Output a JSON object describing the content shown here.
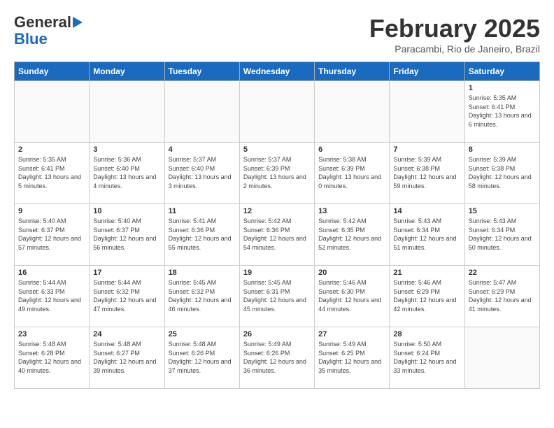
{
  "header": {
    "logo_line1": "General",
    "logo_line2": "Blue",
    "title": "February 2025",
    "subtitle": "Paracambi, Rio de Janeiro, Brazil"
  },
  "days_of_week": [
    "Sunday",
    "Monday",
    "Tuesday",
    "Wednesday",
    "Thursday",
    "Friday",
    "Saturday"
  ],
  "weeks": [
    [
      {
        "num": "",
        "info": ""
      },
      {
        "num": "",
        "info": ""
      },
      {
        "num": "",
        "info": ""
      },
      {
        "num": "",
        "info": ""
      },
      {
        "num": "",
        "info": ""
      },
      {
        "num": "",
        "info": ""
      },
      {
        "num": "1",
        "info": "Sunrise: 5:35 AM\nSunset: 6:41 PM\nDaylight: 13 hours and 6 minutes."
      }
    ],
    [
      {
        "num": "2",
        "info": "Sunrise: 5:35 AM\nSunset: 6:41 PM\nDaylight: 13 hours and 5 minutes."
      },
      {
        "num": "3",
        "info": "Sunrise: 5:36 AM\nSunset: 6:40 PM\nDaylight: 13 hours and 4 minutes."
      },
      {
        "num": "4",
        "info": "Sunrise: 5:37 AM\nSunset: 6:40 PM\nDaylight: 13 hours and 3 minutes."
      },
      {
        "num": "5",
        "info": "Sunrise: 5:37 AM\nSunset: 6:39 PM\nDaylight: 13 hours and 2 minutes."
      },
      {
        "num": "6",
        "info": "Sunrise: 5:38 AM\nSunset: 6:39 PM\nDaylight: 13 hours and 0 minutes."
      },
      {
        "num": "7",
        "info": "Sunrise: 5:39 AM\nSunset: 6:38 PM\nDaylight: 12 hours and 59 minutes."
      },
      {
        "num": "8",
        "info": "Sunrise: 5:39 AM\nSunset: 6:38 PM\nDaylight: 12 hours and 58 minutes."
      }
    ],
    [
      {
        "num": "9",
        "info": "Sunrise: 5:40 AM\nSunset: 6:37 PM\nDaylight: 12 hours and 57 minutes."
      },
      {
        "num": "10",
        "info": "Sunrise: 5:40 AM\nSunset: 6:37 PM\nDaylight: 12 hours and 56 minutes."
      },
      {
        "num": "11",
        "info": "Sunrise: 5:41 AM\nSunset: 6:36 PM\nDaylight: 12 hours and 55 minutes."
      },
      {
        "num": "12",
        "info": "Sunrise: 5:42 AM\nSunset: 6:36 PM\nDaylight: 12 hours and 54 minutes."
      },
      {
        "num": "13",
        "info": "Sunrise: 5:42 AM\nSunset: 6:35 PM\nDaylight: 12 hours and 52 minutes."
      },
      {
        "num": "14",
        "info": "Sunrise: 5:43 AM\nSunset: 6:34 PM\nDaylight: 12 hours and 51 minutes."
      },
      {
        "num": "15",
        "info": "Sunrise: 5:43 AM\nSunset: 6:34 PM\nDaylight: 12 hours and 50 minutes."
      }
    ],
    [
      {
        "num": "16",
        "info": "Sunrise: 5:44 AM\nSunset: 6:33 PM\nDaylight: 12 hours and 49 minutes."
      },
      {
        "num": "17",
        "info": "Sunrise: 5:44 AM\nSunset: 6:32 PM\nDaylight: 12 hours and 47 minutes."
      },
      {
        "num": "18",
        "info": "Sunrise: 5:45 AM\nSunset: 6:32 PM\nDaylight: 12 hours and 46 minutes."
      },
      {
        "num": "19",
        "info": "Sunrise: 5:45 AM\nSunset: 6:31 PM\nDaylight: 12 hours and 45 minutes."
      },
      {
        "num": "20",
        "info": "Sunrise: 5:46 AM\nSunset: 6:30 PM\nDaylight: 12 hours and 44 minutes."
      },
      {
        "num": "21",
        "info": "Sunrise: 5:46 AM\nSunset: 6:29 PM\nDaylight: 12 hours and 42 minutes."
      },
      {
        "num": "22",
        "info": "Sunrise: 5:47 AM\nSunset: 6:29 PM\nDaylight: 12 hours and 41 minutes."
      }
    ],
    [
      {
        "num": "23",
        "info": "Sunrise: 5:48 AM\nSunset: 6:28 PM\nDaylight: 12 hours and 40 minutes."
      },
      {
        "num": "24",
        "info": "Sunrise: 5:48 AM\nSunset: 6:27 PM\nDaylight: 12 hours and 39 minutes."
      },
      {
        "num": "25",
        "info": "Sunrise: 5:48 AM\nSunset: 6:26 PM\nDaylight: 12 hours and 37 minutes."
      },
      {
        "num": "26",
        "info": "Sunrise: 5:49 AM\nSunset: 6:26 PM\nDaylight: 12 hours and 36 minutes."
      },
      {
        "num": "27",
        "info": "Sunrise: 5:49 AM\nSunset: 6:25 PM\nDaylight: 12 hours and 35 minutes."
      },
      {
        "num": "28",
        "info": "Sunrise: 5:50 AM\nSunset: 6:24 PM\nDaylight: 12 hours and 33 minutes."
      },
      {
        "num": "",
        "info": ""
      }
    ]
  ]
}
